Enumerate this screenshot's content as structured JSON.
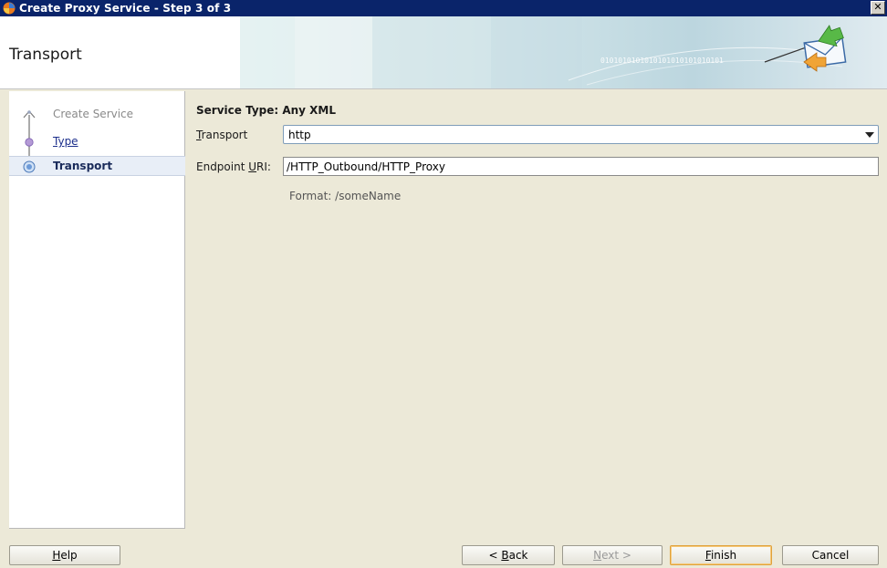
{
  "window": {
    "title": "Create Proxy Service - Step 3 of 3",
    "close_label": "✕"
  },
  "banner": {
    "heading": "Transport",
    "binary_text": "0101010101010101010101010101"
  },
  "nav": {
    "items": [
      {
        "label": "Create Service",
        "state": "disabled"
      },
      {
        "label": "Type",
        "state": "link"
      },
      {
        "label": "Transport",
        "state": "current"
      }
    ]
  },
  "form": {
    "service_type": "Service Type: Any XML",
    "transport_label_pre": "",
    "transport_label_mnemonic": "T",
    "transport_label_post": "ransport",
    "transport_value": "http",
    "endpoint_label_pre": "Endpoint ",
    "endpoint_label_mnemonic": "U",
    "endpoint_label_post": "RI:",
    "endpoint_value": "/HTTP_Outbound/HTTP_Proxy",
    "format_hint": "Format:  /someName"
  },
  "buttons": {
    "help": {
      "mnemonic": "H",
      "rest": "elp"
    },
    "back": {
      "pre": "< ",
      "mnemonic": "B",
      "rest": "ack"
    },
    "next": {
      "mnemonic": "N",
      "rest": "ext >"
    },
    "finish": {
      "mnemonic": "F",
      "rest": "inish"
    },
    "cancel": {
      "label": "Cancel"
    }
  },
  "colors": {
    "titlebar": "#0a246a",
    "link": "#1c2f8c",
    "default_button_border": "#e0a23c"
  }
}
